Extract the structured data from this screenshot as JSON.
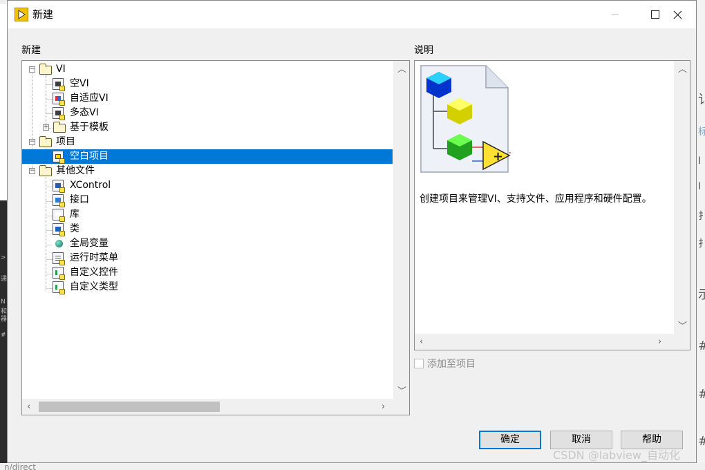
{
  "window": {
    "title": "新建",
    "controls": {
      "minimize": "—",
      "maximize": "☐",
      "close": "✕"
    }
  },
  "tree_section_label": "新建",
  "description_section_label": "说明",
  "tree": [
    {
      "label": "VI",
      "icon": "folder-icon",
      "toggle": "⊟"
    },
    {
      "label": "空VI",
      "icon": "vi-file-icon"
    },
    {
      "label": "自适应VI",
      "icon": "vi-file-icon"
    },
    {
      "label": "多态VI",
      "icon": "vi-file-icon"
    },
    {
      "label": "基于模板",
      "icon": "folder-icon",
      "toggle": "⊞"
    },
    {
      "label": "项目",
      "icon": "folder-icon",
      "toggle": "⊟"
    },
    {
      "label": "空白项目",
      "icon": "project-file-icon",
      "selected": true
    },
    {
      "label": "其他文件",
      "icon": "folder-icon",
      "toggle": "⊟"
    },
    {
      "label": "XControl",
      "icon": "xcontrol-file-icon"
    },
    {
      "label": "接口",
      "icon": "interface-file-icon"
    },
    {
      "label": "库",
      "icon": "library-file-icon"
    },
    {
      "label": "类",
      "icon": "class-file-icon"
    },
    {
      "label": "全局变量",
      "icon": "globe-icon"
    },
    {
      "label": "运行时菜单",
      "icon": "menu-file-icon"
    },
    {
      "label": "自定义控件",
      "icon": "control-file-icon"
    },
    {
      "label": "自定义类型",
      "icon": "typedef-file-icon"
    }
  ],
  "description": {
    "text": "创建项目来管理VI、支持文件、应用程序和硬件配置。",
    "icon": "project-hierarchy-icon"
  },
  "add_to_project_label": "添加至项目",
  "buttons": {
    "ok": "确定",
    "cancel": "取消",
    "help": "帮助"
  },
  "watermark": "CSDN @labview_自动化",
  "colors": {
    "selection": "#0078d7",
    "title_icon": "#f3c000"
  },
  "background": {
    "bottom_link": "n/direct",
    "right_glyphs": [
      "讠",
      "标",
      "I",
      "I",
      "扌",
      "扌",
      "示",
      "#",
      "#",
      "#"
    ],
    "left_glyphs": [
      ">",
      "通",
      "N",
      "和",
      "器",
      "#"
    ]
  }
}
